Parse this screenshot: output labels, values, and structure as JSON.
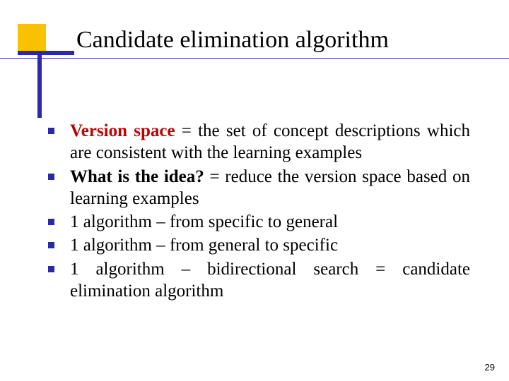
{
  "title": "Candidate elimination algorithm",
  "bullets": [
    {
      "term": "Version space",
      "term_style": "red",
      "rest": " = the set of concept descriptions which are consistent with the learning examples"
    },
    {
      "term": "What is the idea?",
      "term_style": "bold",
      "rest": " = reduce the version space based on learning examples"
    },
    {
      "term": "",
      "term_style": "none",
      "rest": "1 algorithm – from specific to general"
    },
    {
      "term": "",
      "term_style": "none",
      "rest": "1 algorithm – from general to specific"
    },
    {
      "term": "",
      "term_style": "none",
      "rest": "1 algorithm – bidirectional search = candidate elimination algorithm"
    }
  ],
  "page_number": "29"
}
